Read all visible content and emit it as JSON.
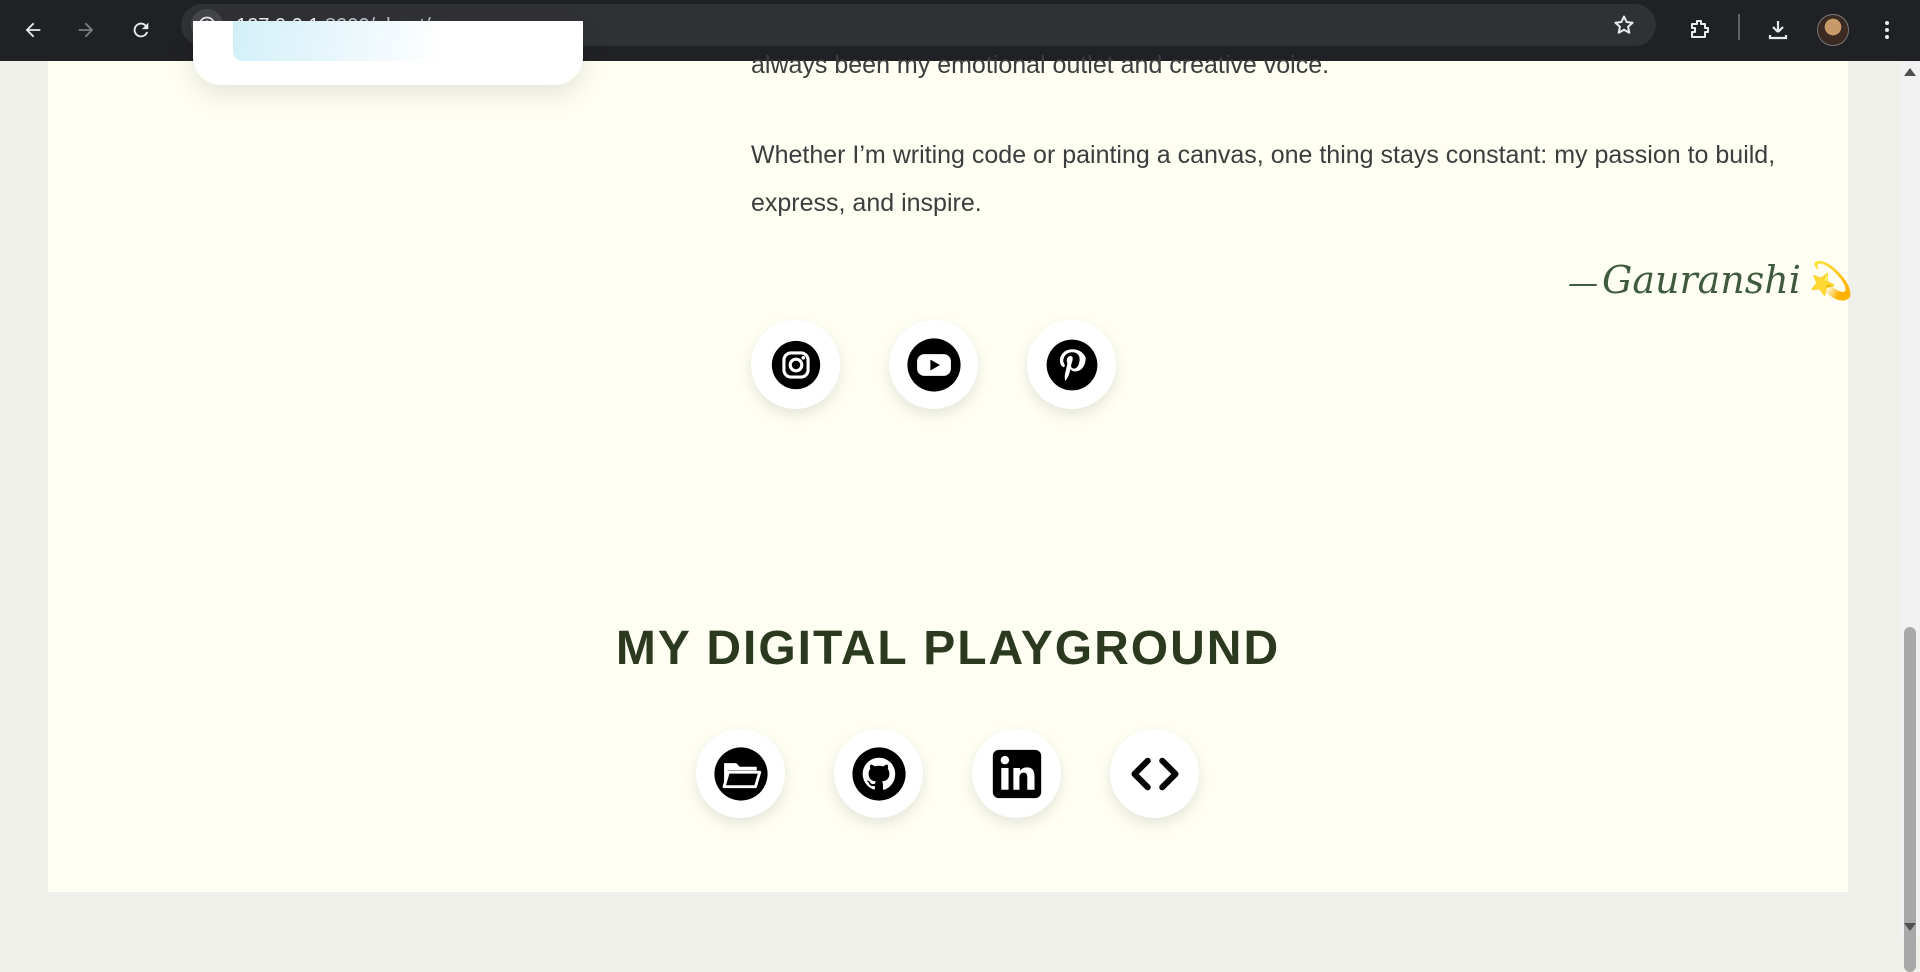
{
  "browser": {
    "url_host": "127.0.0.1",
    "url_path": ":8000/about/",
    "icons": [
      "back-arrow-icon",
      "forward-arrow-icon",
      "reload-icon",
      "site-info-icon",
      "bookmark-star-icon",
      "extensions-icon",
      "download-icon",
      "profile-avatar",
      "more-menu-icon"
    ]
  },
  "about": {
    "cut_line": "always been my emotional outlet and creative voice.",
    "paragraph": "Whether I’m writing code or painting a canvas, one thing stays constant: my passion to build, express, and inspire.",
    "signature_dash": "—",
    "signature_name": "Gauranshi",
    "signature_emoji": "💫"
  },
  "social_links": [
    {
      "name": "instagram",
      "icon": "instagram-icon"
    },
    {
      "name": "youtube",
      "icon": "youtube-icon"
    },
    {
      "name": "pinterest",
      "icon": "pinterest-icon"
    }
  ],
  "playground": {
    "title": "MY DIGITAL PLAYGROUND",
    "links": [
      {
        "name": "portfolio",
        "icon": "folder-icon"
      },
      {
        "name": "github",
        "icon": "github-icon"
      },
      {
        "name": "linkedin",
        "icon": "linkedin-icon"
      },
      {
        "name": "code",
        "icon": "code-icon"
      }
    ]
  },
  "colors": {
    "page_bg": "#fefef3",
    "outer_bg": "#f0f0ea",
    "title": "#2b3a1e",
    "text": "#3d3d3d",
    "signature": "#3f5a3c",
    "accent": "#f2b21b"
  }
}
